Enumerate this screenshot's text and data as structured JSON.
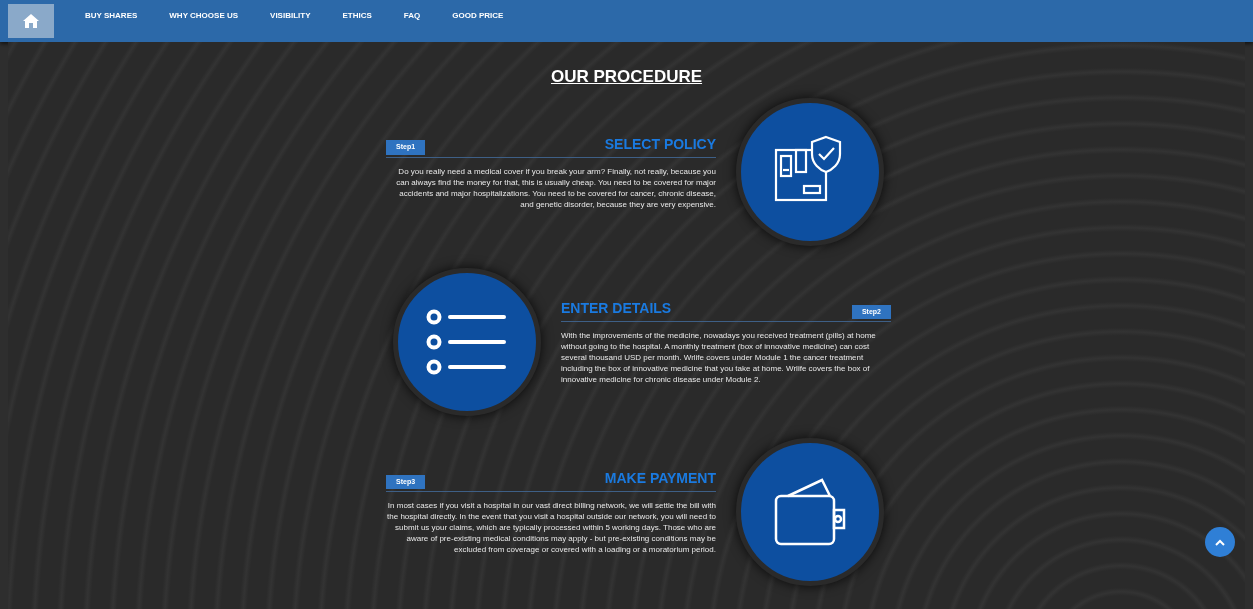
{
  "nav": {
    "items": [
      {
        "kind": "home",
        "selected": true
      },
      {
        "kind": "link",
        "label": "BUY SHARES",
        "selected": false
      },
      {
        "kind": "link",
        "label": "WHY CHOOSE US",
        "selected": false
      },
      {
        "kind": "link",
        "label": "VISIBILITY",
        "selected": false
      },
      {
        "kind": "link",
        "label": "ETHICS",
        "selected": false
      },
      {
        "kind": "link",
        "label": "FAQ",
        "selected": false
      },
      {
        "kind": "link",
        "label": "GOOD PRICE",
        "selected": false
      }
    ]
  },
  "heading": "OUR PROCEDURE",
  "steps": [
    {
      "kind": "policy",
      "badge": "Step1",
      "title": "SELECT POLICY",
      "text": "Do you really need a medical cover if you break your arm? Finally, not really, because you can always find the money for that, this is usually cheap. You need to be covered for major accidents and major hospitalizations. You need to be covered for cancer, chronic disease, and genetic disorder, because they are very expensive."
    },
    {
      "kind": "list",
      "badge": "Step2",
      "title": "ENTER DETAILS",
      "text": "With the improvements of the medicine, nowadays you received treatment (pills) at home without going to the hospital. A monthly treatment (box of innovative medicine) can cost several thousand USD per month. Wrlife covers under Module 1 the cancer treatment including the box of innovative medicine that you take at home. Wrlife covers the box of innovative medicine for chronic disease under Module 2."
    },
    {
      "kind": "wallet",
      "badge": "Step3",
      "title": "MAKE PAYMENT",
      "text": "In most cases if you visit a hospital in our vast direct billing network, we will settle the bill with the hospital directly. In the event that you visit a hospital outside our network, you will need to submit us your claims, which are typically processed within 5 working days. Those who are aware of pre-existing medical conditions may apply - but pre-existing conditions may be excluded from coverage or covered with a loading or a moratorium period."
    }
  ]
}
